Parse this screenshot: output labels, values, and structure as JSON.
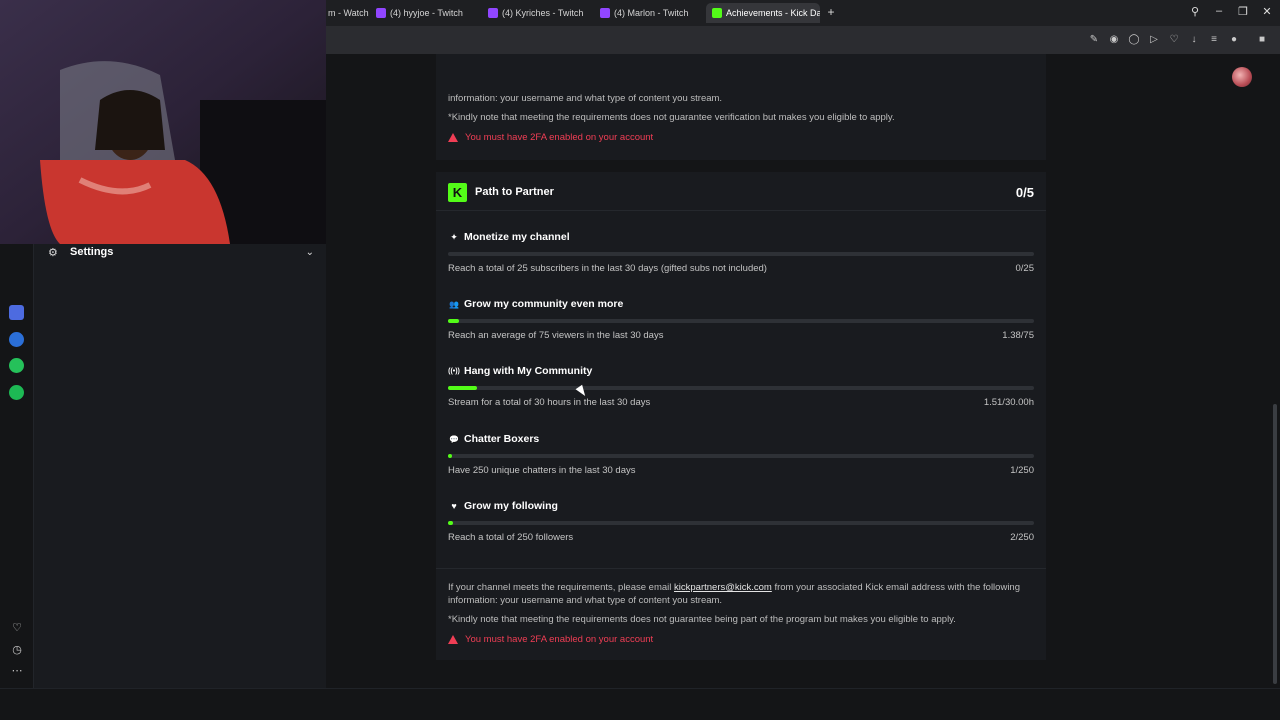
{
  "browser": {
    "tabs": [
      {
        "label": "m - Watch",
        "fav": "#6b6b6b"
      },
      {
        "label": "(4) hyyjoe - Twitch",
        "fav": "#9146ff"
      },
      {
        "label": "(4) Kyriches - Twitch",
        "fav": "#9146ff"
      },
      {
        "label": "(4) Marlon - Twitch",
        "fav": "#9146ff"
      },
      {
        "label": "Achievements - Kick Dash",
        "fav": "#53fc18",
        "active": true
      }
    ]
  },
  "sidebar": {
    "settings_label": "Settings"
  },
  "top_card": {
    "line1": "information: your username and what type of content you stream.",
    "line2": "*Kindly note that meeting the requirements does not guarantee verification but makes you eligible to apply.",
    "warning": "You must have 2FA enabled on your account"
  },
  "path": {
    "title": "Path to Partner",
    "count": "0/5",
    "logo": "K",
    "goals": [
      {
        "title": "Monetize my channel",
        "icon": "sparkle-icon",
        "glyph": "✦",
        "desc": "Reach a total of 25 subscribers in the last 30 days (gifted subs not included)",
        "value": "0/25",
        "progress": 0.0
      },
      {
        "title": "Grow my community even more",
        "icon": "people-icon",
        "glyph": "👥",
        "desc": "Reach an average of 75 viewers in the last 30 days",
        "value": "1.38/75",
        "progress": 0.018
      },
      {
        "title": "Hang with My Community",
        "icon": "broadcast-icon",
        "glyph": "((•))",
        "desc": "Stream for a total of 30 hours in the last 30 days",
        "value": "1.51/30.00h",
        "progress": 0.05
      },
      {
        "title": "Chatter Boxers",
        "icon": "chat-icon",
        "glyph": "💬",
        "desc": "Have 250 unique chatters in the last 30 days",
        "value": "1/250",
        "progress": 0.004
      },
      {
        "title": "Grow my following",
        "icon": "heart-icon",
        "glyph": "♥",
        "desc": "Reach a total of 250 followers",
        "value": "2/250",
        "progress": 0.008
      }
    ],
    "footer_pre": "If your channel meets the requirements, please email ",
    "footer_email": "kickpartners@kick.com",
    "footer_post": " from your associated Kick email address with the following information: your username and what type of content you stream.",
    "footer_note": "*Kindly note that meeting the requirements does not guarantee being part of the program but makes you eligible to apply.",
    "footer_warning": "You must have 2FA enabled on your account"
  },
  "colors": {
    "accent": "#53fc18",
    "warning": "#f03e55",
    "card": "#191b1f",
    "background": "#141517"
  }
}
